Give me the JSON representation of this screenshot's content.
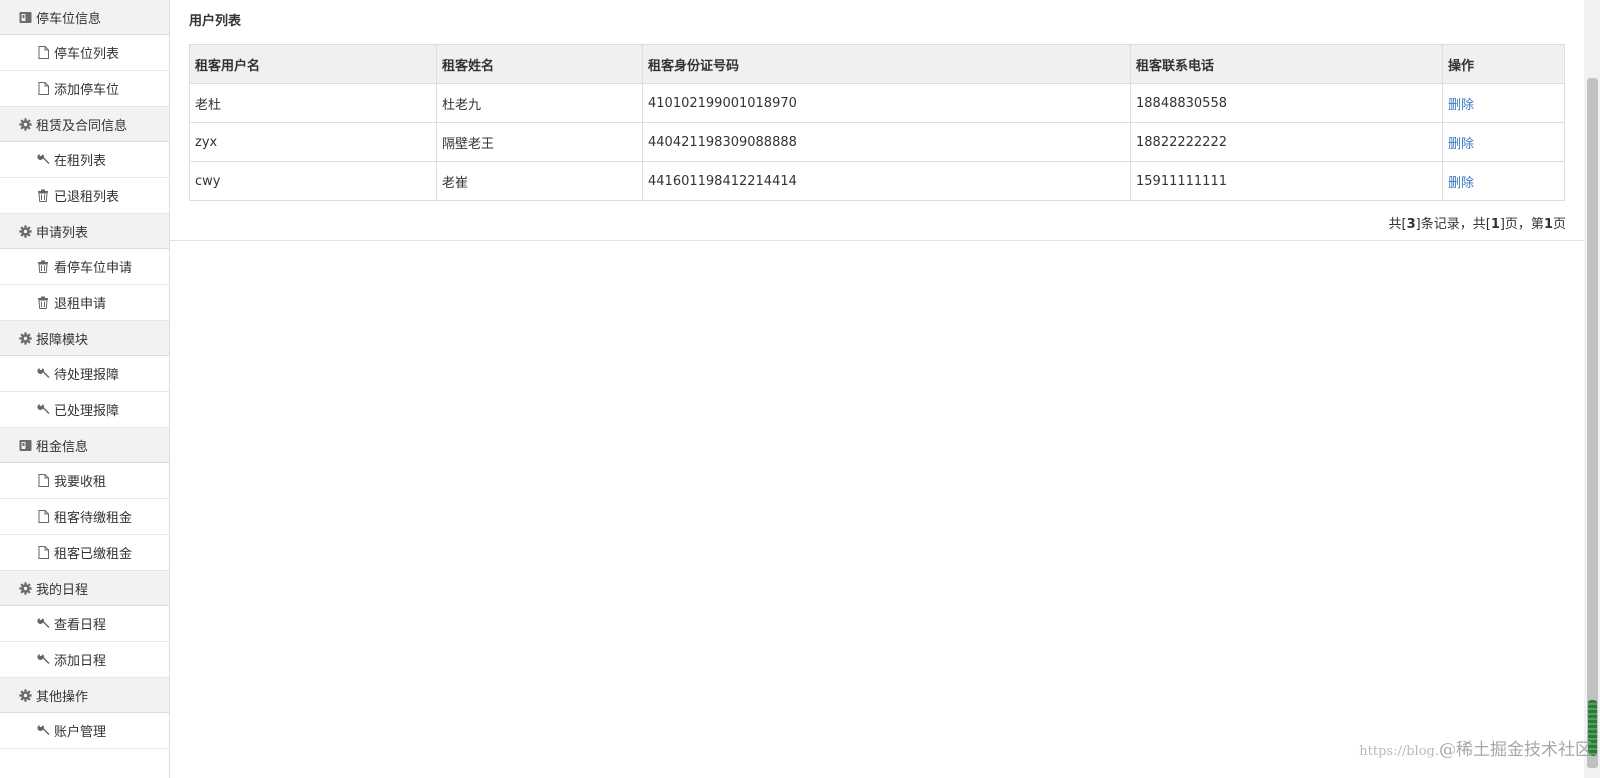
{
  "sidebar": {
    "groups": [
      {
        "label": "停车位信息",
        "items": [
          "停车位列表",
          "添加停车位"
        ]
      },
      {
        "label": "租赁及合同信息",
        "items": [
          "在租列表",
          "已退租列表"
        ]
      },
      {
        "label": "申请列表",
        "items": [
          "看停车位申请",
          "退租申请"
        ]
      },
      {
        "label": "报障模块",
        "items": [
          "待处理报障",
          "已处理报障"
        ]
      },
      {
        "label": "租金信息",
        "items": [
          "我要收租",
          "租客待缴租金",
          "租客已缴租金"
        ]
      },
      {
        "label": "我的日程",
        "items": [
          "查看日程",
          "添加日程"
        ]
      },
      {
        "label": "其他操作",
        "items": [
          "账户管理"
        ]
      }
    ]
  },
  "main": {
    "title": "用户列表",
    "table": {
      "columns": [
        "租客用户名",
        "租客姓名",
        "租客身份证号码",
        "租客联系电话",
        "操作"
      ],
      "rows": [
        {
          "username": "老杜",
          "name": "杜老九",
          "id_number": "410102199001018970",
          "phone": "18848830558",
          "action": "删除"
        },
        {
          "username": "zyx",
          "name": "隔壁老王",
          "id_number": "440421198309088888",
          "phone": "18822222222",
          "action": "删除"
        },
        {
          "username": "cwy",
          "name": "老崔",
          "id_number": "441601198412214414",
          "phone": "15911111111",
          "action": "删除"
        }
      ]
    },
    "pager": {
      "prefix": "共[",
      "total_records": "3",
      "mid1": "]条记录，共[",
      "total_pages": "1",
      "mid2": "]页，第",
      "current_page": "1",
      "suffix": "页"
    }
  },
  "watermark": {
    "url_text": "https://blog.",
    "site_text": "@稀土掘金技术社区"
  }
}
